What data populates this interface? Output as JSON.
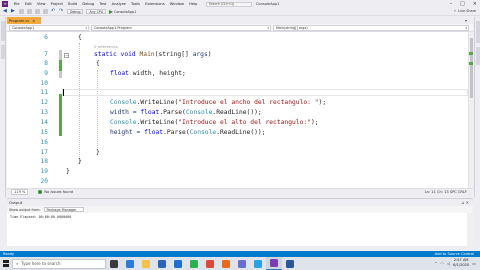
{
  "titlebar": {
    "menu": [
      "File",
      "Edit",
      "View",
      "Project",
      "Build",
      "Debug",
      "Test",
      "Analyze",
      "Tools",
      "Extensions",
      "Window",
      "Help"
    ],
    "search_placeholder": "Search (Ctrl+Q)",
    "project_name": "ConsoleApp1"
  },
  "toolbar": {
    "configuration": "Debug",
    "platform": "Any CPU",
    "start_label": "ConsoleApp1",
    "live_share": "Live Share"
  },
  "doc_tab": {
    "label": "Program.cs",
    "close": "×"
  },
  "navbar": {
    "project": "ConsoleApp1",
    "type": "ConsoleApp1.Program",
    "member": "Main(string[] args)"
  },
  "editor": {
    "lines": [
      {
        "n": "6",
        "text": "{"
      },
      {
        "n": "7",
        "refs": "0 references",
        "kw": "static void ",
        "method": "Main",
        "rest": "(string[] ",
        "param": "args",
        "end": ")"
      },
      {
        "n": "8",
        "text": "{"
      },
      {
        "n": "9",
        "kw": "float ",
        "rest": "width, height;"
      },
      {
        "n": "10"
      },
      {
        "n": "11"
      },
      {
        "n": "12",
        "type": "Console",
        "method": ".WriteLine(",
        "str": "\"Introduce el ancho del rectangulo: \"",
        "end": ");"
      },
      {
        "n": "13",
        "text": "width = ",
        "kw": "float",
        "rest": ".Parse(",
        "type": "Console",
        "method": ".ReadLine",
        "end": "());"
      },
      {
        "n": "14",
        "type": "Console",
        "method": ".WriteLine(",
        "str": "\"Introduce el alto del rectangulo:\"",
        "end": ");"
      },
      {
        "n": "15",
        "text": "height = ",
        "kw": "float",
        "rest": ".Parse(",
        "type": "Console",
        "method": ".ReadLine",
        "end": "());"
      },
      {
        "n": "16"
      },
      {
        "n": "17",
        "text": "}"
      },
      {
        "n": "18",
        "text": "}"
      },
      {
        "n": "19",
        "text": "}"
      },
      {
        "n": "20"
      }
    ]
  },
  "edstatus": {
    "zoom": "119 %",
    "issues": "No issues found",
    "position": "Ln: 11  Ch: 13  SPC  CRLF"
  },
  "output": {
    "title": "Output",
    "show_from_label": "Show output from:",
    "source": "Package Manager",
    "line": "Time Elapsed: 00:00:00.0000000"
  },
  "statusbar": {
    "left": "Ready",
    "right": "Add to Source Control"
  },
  "taskbar": {
    "search_placeholder": "Type here to search",
    "time": "2:57 AM",
    "date": "6/1/2020",
    "apps": [
      {
        "name": "task-view",
        "color": "#3b3b3b"
      },
      {
        "name": "edge",
        "color": "#2f7ad6"
      },
      {
        "name": "file-explorer",
        "color": "#f2c14e"
      },
      {
        "name": "store",
        "color": "#2b63b8"
      },
      {
        "name": "mail",
        "color": "#1f6fd0"
      },
      {
        "name": "spotify",
        "color": "#2bb14f"
      },
      {
        "name": "chrome",
        "color": "#d84a3a"
      },
      {
        "name": "firefox",
        "color": "#e66a1f"
      },
      {
        "name": "photos",
        "color": "#6a6fcf"
      },
      {
        "name": "skype",
        "color": "#2aa1e0"
      },
      {
        "name": "visual-studio",
        "color": "#7a3fb0"
      },
      {
        "name": "word",
        "color": "#2b5797"
      }
    ]
  },
  "colors": {
    "accent": "#007acc",
    "tab_active": "#f2a83a",
    "keyword": "#0000ff",
    "type": "#2b91af",
    "string": "#a31515",
    "change_bar": "#57a64a"
  }
}
